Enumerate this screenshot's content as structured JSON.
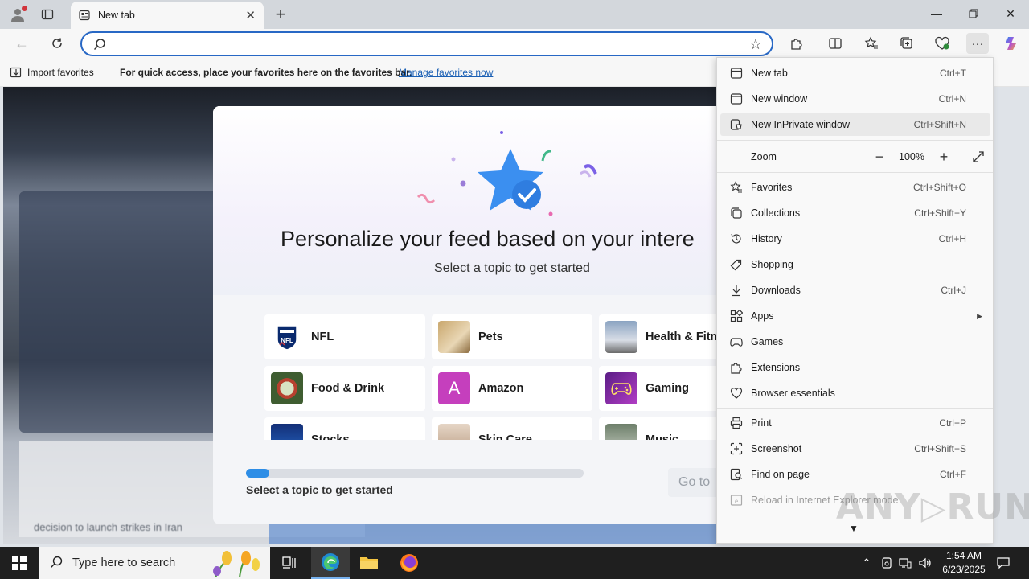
{
  "browser": {
    "tab_title": "New tab",
    "address_placeholder": "",
    "favorites_bar": {
      "import_label": "Import favorites",
      "message": "For quick access, place your favorites here on the favorites bar.",
      "link": "Manage favorites now"
    }
  },
  "dialog": {
    "title": "Personalize your feed based on your intere",
    "subtitle": "Select a topic to get started",
    "topics": [
      {
        "label": "NFL"
      },
      {
        "label": "Pets"
      },
      {
        "label": "Health & Fitne"
      },
      {
        "label": "Food & Drink"
      },
      {
        "label": "Amazon",
        "letter": "A"
      },
      {
        "label": "Gaming"
      },
      {
        "label": "Stocks"
      },
      {
        "label": "Skin Care"
      },
      {
        "label": "Music"
      }
    ],
    "progress_fraction": 0.07,
    "progress_label": "Select a topic to get started",
    "next_button": "Go to"
  },
  "menu": {
    "items": [
      {
        "label": "New tab",
        "shortcut": "Ctrl+T",
        "icon": "new-tab-icon"
      },
      {
        "label": "New window",
        "shortcut": "Ctrl+N",
        "icon": "window-icon"
      },
      {
        "label": "New InPrivate window",
        "shortcut": "Ctrl+Shift+N",
        "icon": "inprivate-icon"
      },
      {
        "label": "Favorites",
        "shortcut": "Ctrl+Shift+O",
        "icon": "favorites-icon"
      },
      {
        "label": "Collections",
        "shortcut": "Ctrl+Shift+Y",
        "icon": "collections-icon"
      },
      {
        "label": "History",
        "shortcut": "Ctrl+H",
        "icon": "history-icon"
      },
      {
        "label": "Shopping",
        "shortcut": "",
        "icon": "shopping-tag-icon"
      },
      {
        "label": "Downloads",
        "shortcut": "Ctrl+J",
        "icon": "download-icon"
      },
      {
        "label": "Apps",
        "shortcut": "",
        "icon": "apps-icon"
      },
      {
        "label": "Games",
        "shortcut": "",
        "icon": "games-icon"
      },
      {
        "label": "Extensions",
        "shortcut": "",
        "icon": "extensions-icon"
      },
      {
        "label": "Browser essentials",
        "shortcut": "",
        "icon": "essentials-icon"
      },
      {
        "label": "Print",
        "shortcut": "Ctrl+P",
        "icon": "print-icon"
      },
      {
        "label": "Screenshot",
        "shortcut": "Ctrl+Shift+S",
        "icon": "screenshot-icon"
      },
      {
        "label": "Find on page",
        "shortcut": "Ctrl+F",
        "icon": "find-icon"
      },
      {
        "label": "Reload in Internet Explorer mode",
        "shortcut": "",
        "icon": "ie-mode-icon"
      }
    ],
    "zoom": {
      "label": "Zoom",
      "value": "100%",
      "minus": "−",
      "plus": "+"
    }
  },
  "page_background": {
    "blurred_text": "decision to launch strikes in Iran"
  },
  "taskbar": {
    "search_placeholder": "Type here to search",
    "time": "1:54 AM",
    "date": "6/23/2025"
  },
  "watermark": "ANY RUN",
  "colors": {
    "accent": "#2868c5",
    "progress": "#2d8de6",
    "amazon_tile": "#c53fbd"
  }
}
